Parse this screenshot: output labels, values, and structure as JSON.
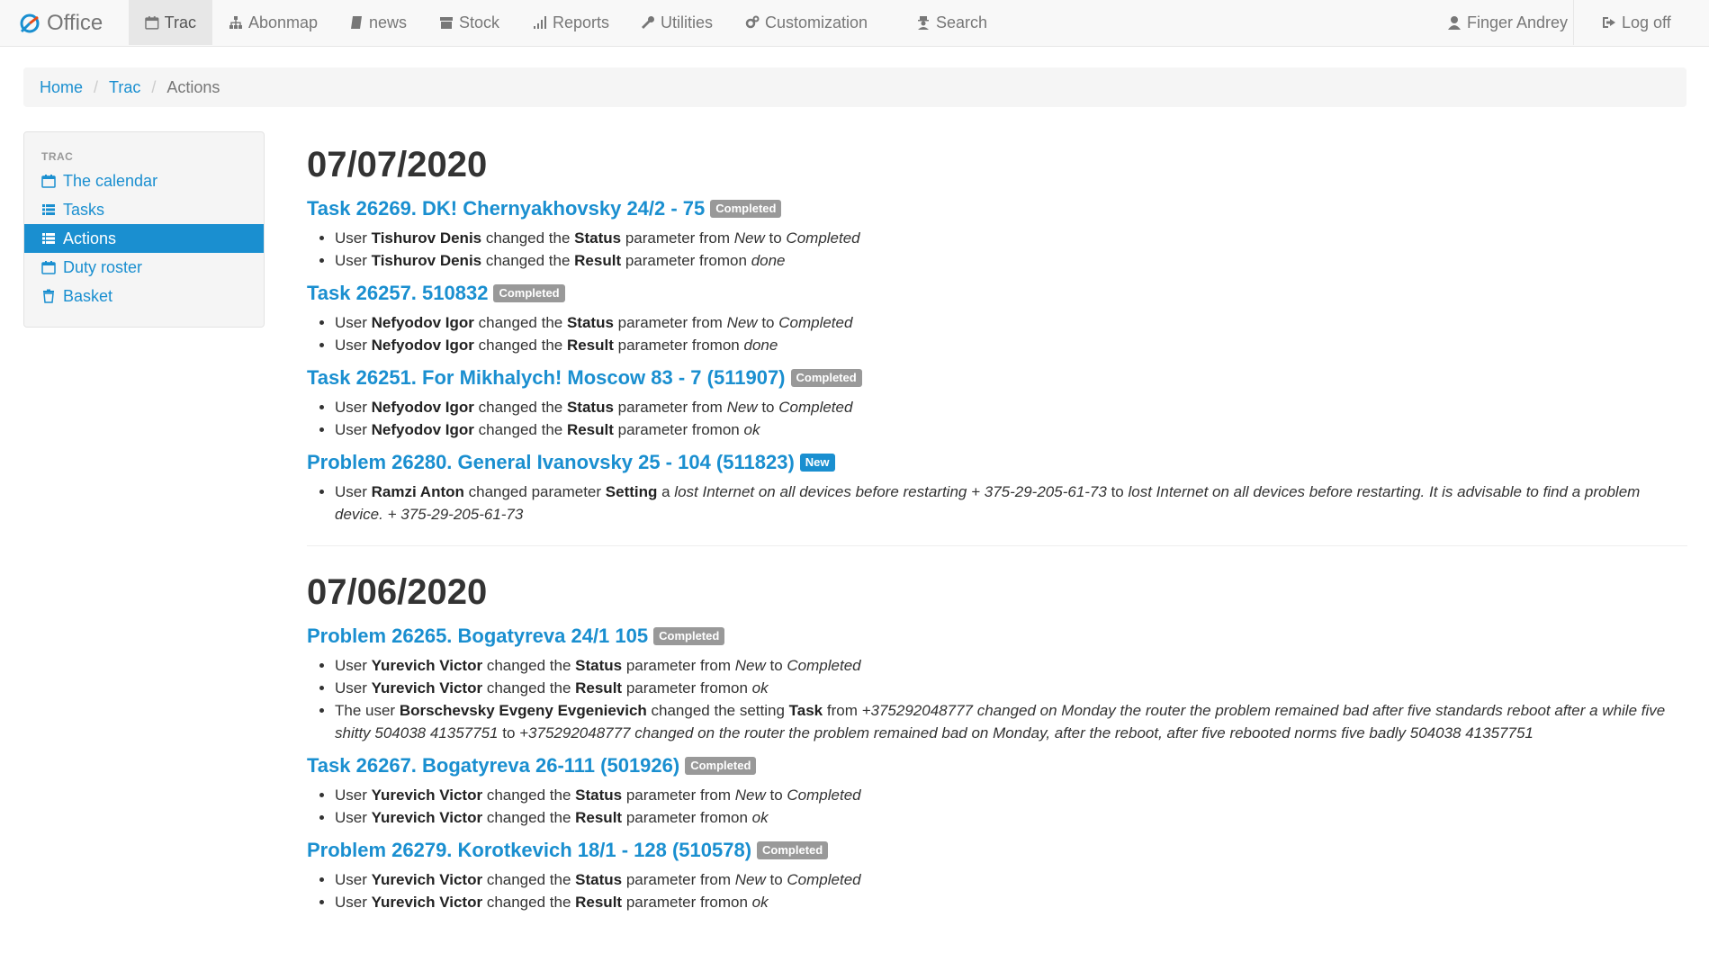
{
  "nav": {
    "brand": "Office",
    "items": [
      {
        "label": "Trac",
        "icon": "calendar-icon"
      },
      {
        "label": "Abonmap",
        "icon": "sitemap-icon"
      },
      {
        "label": "news",
        "icon": "book-icon"
      },
      {
        "label": "Stock",
        "icon": "archive-icon"
      },
      {
        "label": "Reports",
        "icon": "bar-chart-icon"
      },
      {
        "label": "Utilities",
        "icon": "wrench-icon"
      },
      {
        "label": "Customization",
        "icon": "gears-icon"
      },
      {
        "label": "Search",
        "icon": "user-secret-icon"
      }
    ],
    "user": "Finger Andrey",
    "logoff": "Log off"
  },
  "breadcrumb": {
    "home": "Home",
    "trac": "Trac",
    "current": "Actions"
  },
  "sidebar": {
    "header": "TRAC",
    "items": [
      {
        "label": "The calendar",
        "icon": "calendar-icon"
      },
      {
        "label": "Tasks",
        "icon": "list-icon"
      },
      {
        "label": "Actions",
        "icon": "list-icon"
      },
      {
        "label": "Duty roster",
        "icon": "calendar-icon"
      },
      {
        "label": "Basket",
        "icon": "trash-icon"
      }
    ]
  },
  "days": [
    {
      "date": "07/07/2020",
      "entries": [
        {
          "title": "Task 26269. DK! Chernyakhovsky 24/2 - 75",
          "badge": "Completed",
          "changes": [
            {
              "pre": "User ",
              "user": "Tishurov Denis",
              "mid": " changed the ",
              "param": "Status",
              "mid2": " parameter from ",
              "from": "New",
              "to_word": " to ",
              "to": "Completed"
            },
            {
              "pre": "User ",
              "user": "Tishurov Denis",
              "mid": " changed the ",
              "param": "Result",
              "mid2": " parameter fromon ",
              "from": "",
              "to_word": "",
              "to": "done"
            }
          ]
        },
        {
          "title": "Task 26257. 510832",
          "badge": "Completed",
          "changes": [
            {
              "pre": "User ",
              "user": "Nefyodov Igor",
              "mid": " changed the ",
              "param": "Status",
              "mid2": " parameter from ",
              "from": "New",
              "to_word": " to ",
              "to": "Completed"
            },
            {
              "pre": "User ",
              "user": "Nefyodov Igor",
              "mid": " changed the ",
              "param": "Result",
              "mid2": " parameter fromon ",
              "from": "",
              "to_word": "",
              "to": "done"
            }
          ]
        },
        {
          "title": "Task 26251. For Mikhalych! Moscow 83 - 7 (511907)",
          "badge": "Completed",
          "changes": [
            {
              "pre": "User ",
              "user": "Nefyodov Igor",
              "mid": " changed the ",
              "param": "Status",
              "mid2": " parameter from ",
              "from": "New",
              "to_word": " to ",
              "to": "Completed"
            },
            {
              "pre": "User ",
              "user": "Nefyodov Igor",
              "mid": " changed the ",
              "param": "Result",
              "mid2": " parameter fromon ",
              "from": "",
              "to_word": "",
              "to": "ok"
            }
          ]
        },
        {
          "title": "Problem 26280. General Ivanovsky 25 - 104 (511823)",
          "badge": "New",
          "badge_new": true,
          "changes": [
            {
              "pre": "User ",
              "user": "Ramzi Anton",
              "mid": " changed parameter ",
              "param": "Setting",
              "mid2": " a ",
              "from": "lost Internet on all devices before restarting + 375-29-205-61-73",
              "to_word": " to ",
              "to": "lost Internet on all devices before restarting. It is advisable to find a problem device. + 375-29-205-61-73"
            }
          ]
        }
      ]
    },
    {
      "date": "07/06/2020",
      "entries": [
        {
          "title": "Problem 26265. Bogatyreva 24/1 105",
          "badge": "Completed",
          "changes": [
            {
              "pre": "User ",
              "user": "Yurevich Victor",
              "mid": " changed the ",
              "param": "Status",
              "mid2": " parameter from ",
              "from": "New",
              "to_word": " to ",
              "to": "Completed"
            },
            {
              "pre": "User ",
              "user": "Yurevich Victor",
              "mid": " changed the ",
              "param": "Result",
              "mid2": " parameter fromon ",
              "from": "",
              "to_word": "",
              "to": "ok"
            },
            {
              "pre": "The user ",
              "user": "Borschevsky Evgeny Evgenievich",
              "mid": " changed the setting ",
              "param": "Task",
              "mid2": " from ",
              "from": "+375292048777 changed on Monday the router the problem remained bad after five standards reboot after a while five shitty 504038 41357751",
              "to_word": " to ",
              "to": "+375292048777 changed on the router the problem remained bad on Monday, after the reboot, after five rebooted norms five badly 504038 41357751"
            }
          ]
        },
        {
          "title": "Task 26267. Bogatyreva 26-111 (501926)",
          "badge": "Completed",
          "changes": [
            {
              "pre": "User ",
              "user": "Yurevich Victor",
              "mid": " changed the ",
              "param": "Status",
              "mid2": " parameter from ",
              "from": "New",
              "to_word": " to ",
              "to": "Completed"
            },
            {
              "pre": "User ",
              "user": "Yurevich Victor",
              "mid": " changed the ",
              "param": "Result",
              "mid2": " parameter fromon ",
              "from": "",
              "to_word": "",
              "to": "ok"
            }
          ]
        },
        {
          "title": "Problem 26279. Korotkevich 18/1 - 128 (510578)",
          "badge": "Completed",
          "changes": [
            {
              "pre": "User ",
              "user": "Yurevich Victor",
              "mid": " changed the ",
              "param": "Status",
              "mid2": " parameter from ",
              "from": "New",
              "to_word": " to ",
              "to": "Completed"
            },
            {
              "pre": "User ",
              "user": "Yurevich Victor",
              "mid": " changed the ",
              "param": "Result",
              "mid2": " parameter fromon ",
              "from": "",
              "to_word": "",
              "to": "ok"
            }
          ]
        }
      ]
    }
  ]
}
